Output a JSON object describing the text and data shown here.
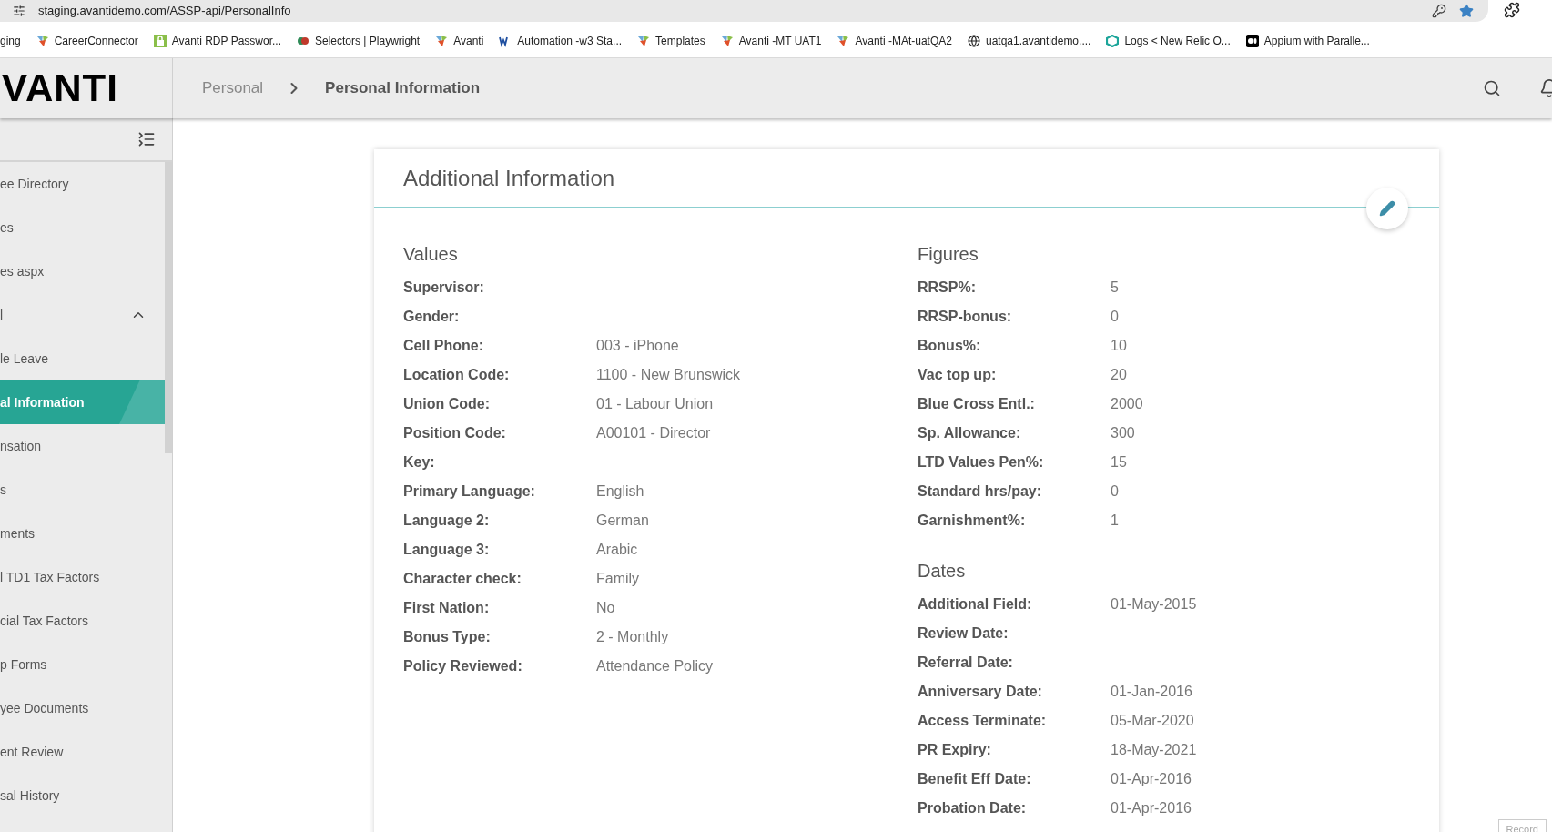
{
  "browser": {
    "url": "staging.avantidemo.com/ASSP-api/PersonalInfo",
    "bookmarks": [
      {
        "label": "ging",
        "kind": "plain"
      },
      {
        "label": "CareerConnector",
        "kind": "avanti"
      },
      {
        "label": "Avanti RDP Passwor...",
        "kind": "lock"
      },
      {
        "label": "Selectors | Playwright",
        "kind": "mask"
      },
      {
        "label": "Avanti",
        "kind": "avanti"
      },
      {
        "label": "Automation -w3 Sta...",
        "kind": "w3"
      },
      {
        "label": "Templates",
        "kind": "avanti"
      },
      {
        "label": "Avanti -MT UAT1",
        "kind": "avanti"
      },
      {
        "label": "Avanti -MAt-uatQA2",
        "kind": "avanti"
      },
      {
        "label": "uatqa1.avantidemo....",
        "kind": "globe"
      },
      {
        "label": "Logs < New Relic O...",
        "kind": "relic"
      },
      {
        "label": "Appium with Paralle...",
        "kind": "medium"
      }
    ]
  },
  "header": {
    "logo": "VANTI",
    "breadcrumb": [
      {
        "label": "Personal",
        "selected": false
      },
      {
        "label": "Personal Information",
        "selected": true
      }
    ]
  },
  "sidebar": {
    "items": [
      {
        "label": "ee Directory",
        "selected": false
      },
      {
        "label": "es",
        "selected": false
      },
      {
        "label": "es aspx",
        "selected": false
      },
      {
        "label": "l",
        "selected": false,
        "expanded": true
      },
      {
        "label": "le Leave",
        "selected": false
      },
      {
        "label": "al Information",
        "selected": true
      },
      {
        "label": "nsation",
        "selected": false
      },
      {
        "label": "s",
        "selected": false
      },
      {
        "label": "ments",
        "selected": false
      },
      {
        "label": "l TD1 Tax Factors",
        "selected": false
      },
      {
        "label": "cial Tax Factors",
        "selected": false
      },
      {
        "label": "p Forms",
        "selected": false
      },
      {
        "label": "yee Documents",
        "selected": false
      },
      {
        "label": "ent Review",
        "selected": false
      },
      {
        "label": "sal History",
        "selected": false
      }
    ]
  },
  "card": {
    "title": "Additional Information",
    "left": [
      {
        "heading": "Values",
        "rows": [
          {
            "label": "Supervisor:"
          },
          {
            "label": "Gender:"
          },
          {
            "label": "Cell Phone:",
            "value": "003 - iPhone"
          },
          {
            "label": "Location Code:",
            "value": "1100 - New Brunswick"
          },
          {
            "label": "Union Code:",
            "value": "01 - Labour Union"
          },
          {
            "label": "Position Code:",
            "value": "A00101 - Director"
          },
          {
            "label": "Key:"
          },
          {
            "label": "Primary Language:",
            "value": "English"
          },
          {
            "label": "Language 2:",
            "value": "German"
          },
          {
            "label": "Language 3:",
            "value": "Arabic"
          },
          {
            "label": "Character check:",
            "value": "Family"
          },
          {
            "label": "First Nation:",
            "value": "No"
          },
          {
            "label": "Bonus Type:",
            "value": "2 - Monthly"
          },
          {
            "label": "Policy Reviewed:",
            "value": "Attendance Policy"
          }
        ]
      }
    ],
    "right": [
      {
        "heading": "Figures",
        "rows": [
          {
            "label": "RRSP%:",
            "value": "5"
          },
          {
            "label": "RRSP-bonus:",
            "value": "0"
          },
          {
            "label": "Bonus%:",
            "value": "10"
          },
          {
            "label": "Vac top up:",
            "value": "20"
          },
          {
            "label": "Blue Cross Entl.:",
            "value": "2000"
          },
          {
            "label": "Sp. Allowance:",
            "value": "300"
          },
          {
            "label": "LTD Values Pen%:",
            "value": "15"
          },
          {
            "label": "Standard hrs/pay:",
            "value": "0"
          },
          {
            "label": "Garnishment%:",
            "value": "1"
          }
        ]
      },
      {
        "heading": "Dates",
        "rows": [
          {
            "label": "Additional Field:",
            "value": "01-May-2015"
          },
          {
            "label": "Review Date:"
          },
          {
            "label": "Referral Date:"
          },
          {
            "label": "Anniversary Date:",
            "value": "01-Jan-2016"
          },
          {
            "label": "Access Terminate:",
            "value": "05-Mar-2020"
          },
          {
            "label": "PR Expiry:",
            "value": "18-May-2021"
          },
          {
            "label": "Benefit Eff Date:",
            "value": "01-Apr-2016"
          },
          {
            "label": "Probation Date:",
            "value": "01-Apr-2016"
          }
        ]
      }
    ]
  },
  "record_button": "Record"
}
